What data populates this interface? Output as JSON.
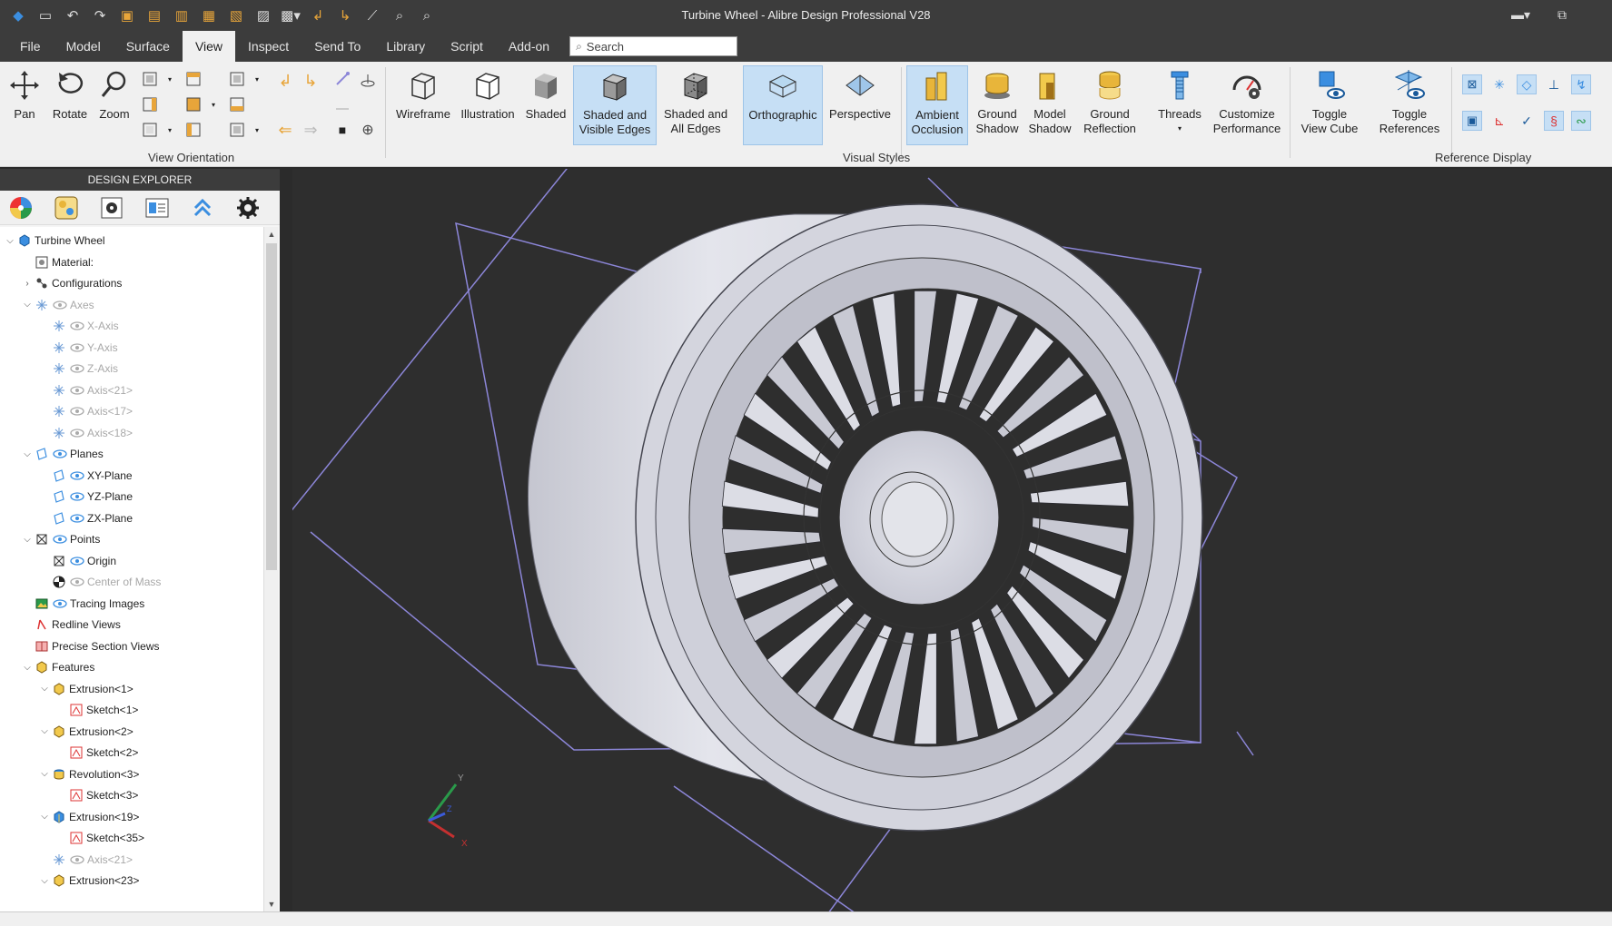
{
  "window": {
    "title": "Turbine Wheel - Alibre Design Professional V28"
  },
  "menu": {
    "items": [
      "File",
      "Model",
      "Surface",
      "View",
      "Inspect",
      "Send To",
      "Library",
      "Script",
      "Add-on"
    ],
    "active": "View",
    "search_placeholder": "Search"
  },
  "ribbon": {
    "pan": "Pan",
    "rotate": "Rotate",
    "zoom": "Zoom",
    "wireframe": "Wireframe",
    "illustration": "Illustration",
    "shaded": "Shaded",
    "shaded_visible_1": "Shaded and",
    "shaded_visible_2": "Visible Edges",
    "shaded_all_1": "Shaded and",
    "shaded_all_2": "All Edges",
    "orthographic": "Orthographic",
    "perspective": "Perspective",
    "ambient_1": "Ambient",
    "ambient_2": "Occlusion",
    "ground_shadow_1": "Ground",
    "ground_shadow_2": "Shadow",
    "model_shadow_1": "Model",
    "model_shadow_2": "Shadow",
    "ground_reflection_1": "Ground",
    "ground_reflection_2": "Reflection",
    "threads": "Threads",
    "customize_1": "Customize",
    "customize_2": "Performance",
    "toggle_cube_1": "Toggle",
    "toggle_cube_2": "View Cube",
    "toggle_refs_1": "Toggle",
    "toggle_refs_2": "References",
    "group_view_orientation": "View Orientation",
    "group_visual_styles": "Visual Styles",
    "group_reference_display": "Reference Display"
  },
  "explorer": {
    "header": "DESIGN EXPLORER",
    "tree": [
      {
        "label": "Turbine Wheel",
        "indent": 0,
        "twisty": "v",
        "icon": "part",
        "dim": false
      },
      {
        "label": "Material:",
        "indent": 1,
        "twisty": "",
        "icon": "material",
        "dim": false
      },
      {
        "label": "Configurations",
        "indent": 1,
        "twisty": ">",
        "icon": "config",
        "dim": false
      },
      {
        "label": "Axes",
        "indent": 1,
        "twisty": "v",
        "icon": "axis",
        "eye": true,
        "dim": true
      },
      {
        "label": "X-Axis",
        "indent": 2,
        "twisty": "",
        "icon": "axis",
        "eye": true,
        "dim": true
      },
      {
        "label": "Y-Axis",
        "indent": 2,
        "twisty": "",
        "icon": "axis",
        "eye": true,
        "dim": true
      },
      {
        "label": "Z-Axis",
        "indent": 2,
        "twisty": "",
        "icon": "axis",
        "eye": true,
        "dim": true
      },
      {
        "label": "Axis<21>",
        "indent": 2,
        "twisty": "",
        "icon": "axis",
        "eye": true,
        "dim": true
      },
      {
        "label": "Axis<17>",
        "indent": 2,
        "twisty": "",
        "icon": "axis",
        "eye": true,
        "dim": true
      },
      {
        "label": "Axis<18>",
        "indent": 2,
        "twisty": "",
        "icon": "axis",
        "eye": true,
        "dim": true
      },
      {
        "label": "Planes",
        "indent": 1,
        "twisty": "v",
        "icon": "plane",
        "eye": true,
        "dim": false
      },
      {
        "label": "XY-Plane",
        "indent": 2,
        "twisty": "",
        "icon": "plane",
        "eye": true,
        "dim": false
      },
      {
        "label": "YZ-Plane",
        "indent": 2,
        "twisty": "",
        "icon": "plane",
        "eye": true,
        "dim": false
      },
      {
        "label": "ZX-Plane",
        "indent": 2,
        "twisty": "",
        "icon": "plane",
        "eye": true,
        "dim": false
      },
      {
        "label": "Points",
        "indent": 1,
        "twisty": "v",
        "icon": "point",
        "eye": true,
        "dim": false
      },
      {
        "label": "Origin",
        "indent": 2,
        "twisty": "",
        "icon": "point",
        "eye": true,
        "dim": false
      },
      {
        "label": "Center of Mass",
        "indent": 2,
        "twisty": "",
        "icon": "mass",
        "eye": true,
        "dim": true
      },
      {
        "label": "Tracing Images",
        "indent": 1,
        "twisty": "",
        "icon": "image",
        "eye": true,
        "dim": false
      },
      {
        "label": "Redline Views",
        "indent": 1,
        "twisty": "",
        "icon": "redline",
        "dim": false
      },
      {
        "label": "Precise Section Views",
        "indent": 1,
        "twisty": "",
        "icon": "section",
        "dim": false
      },
      {
        "label": "Features",
        "indent": 1,
        "twisty": "v",
        "icon": "feature",
        "dim": false
      },
      {
        "label": "Extrusion<1>",
        "indent": 2,
        "twisty": "v",
        "icon": "feature",
        "dim": false
      },
      {
        "label": "Sketch<1>",
        "indent": 3,
        "twisty": "",
        "icon": "sketch",
        "dim": false
      },
      {
        "label": "Extrusion<2>",
        "indent": 2,
        "twisty": "v",
        "icon": "feature",
        "dim": false
      },
      {
        "label": "Sketch<2>",
        "indent": 3,
        "twisty": "",
        "icon": "sketch",
        "dim": false
      },
      {
        "label": "Revolution<3>",
        "indent": 2,
        "twisty": "v",
        "icon": "revolve",
        "dim": false
      },
      {
        "label": "Sketch<3>",
        "indent": 3,
        "twisty": "",
        "icon": "sketch",
        "dim": false
      },
      {
        "label": "Extrusion<19>",
        "indent": 2,
        "twisty": "v",
        "icon": "extrude-blue",
        "dim": false
      },
      {
        "label": "Sketch<35>",
        "indent": 3,
        "twisty": "",
        "icon": "sketch",
        "dim": false
      },
      {
        "label": "Axis<21>",
        "indent": 2,
        "twisty": "",
        "icon": "axis",
        "eye": true,
        "dim": true
      },
      {
        "label": "Extrusion<23>",
        "indent": 2,
        "twisty": "v",
        "icon": "feature",
        "dim": false
      }
    ]
  },
  "triad": {
    "x": "X",
    "y": "Y",
    "z": "Z"
  },
  "colors": {
    "accent": "#2a7fd4",
    "selection": "#c6dff5",
    "viewport": "#2e2e2e",
    "plane_lines": "#8c86d8",
    "model_surface": "#d4d5de"
  }
}
